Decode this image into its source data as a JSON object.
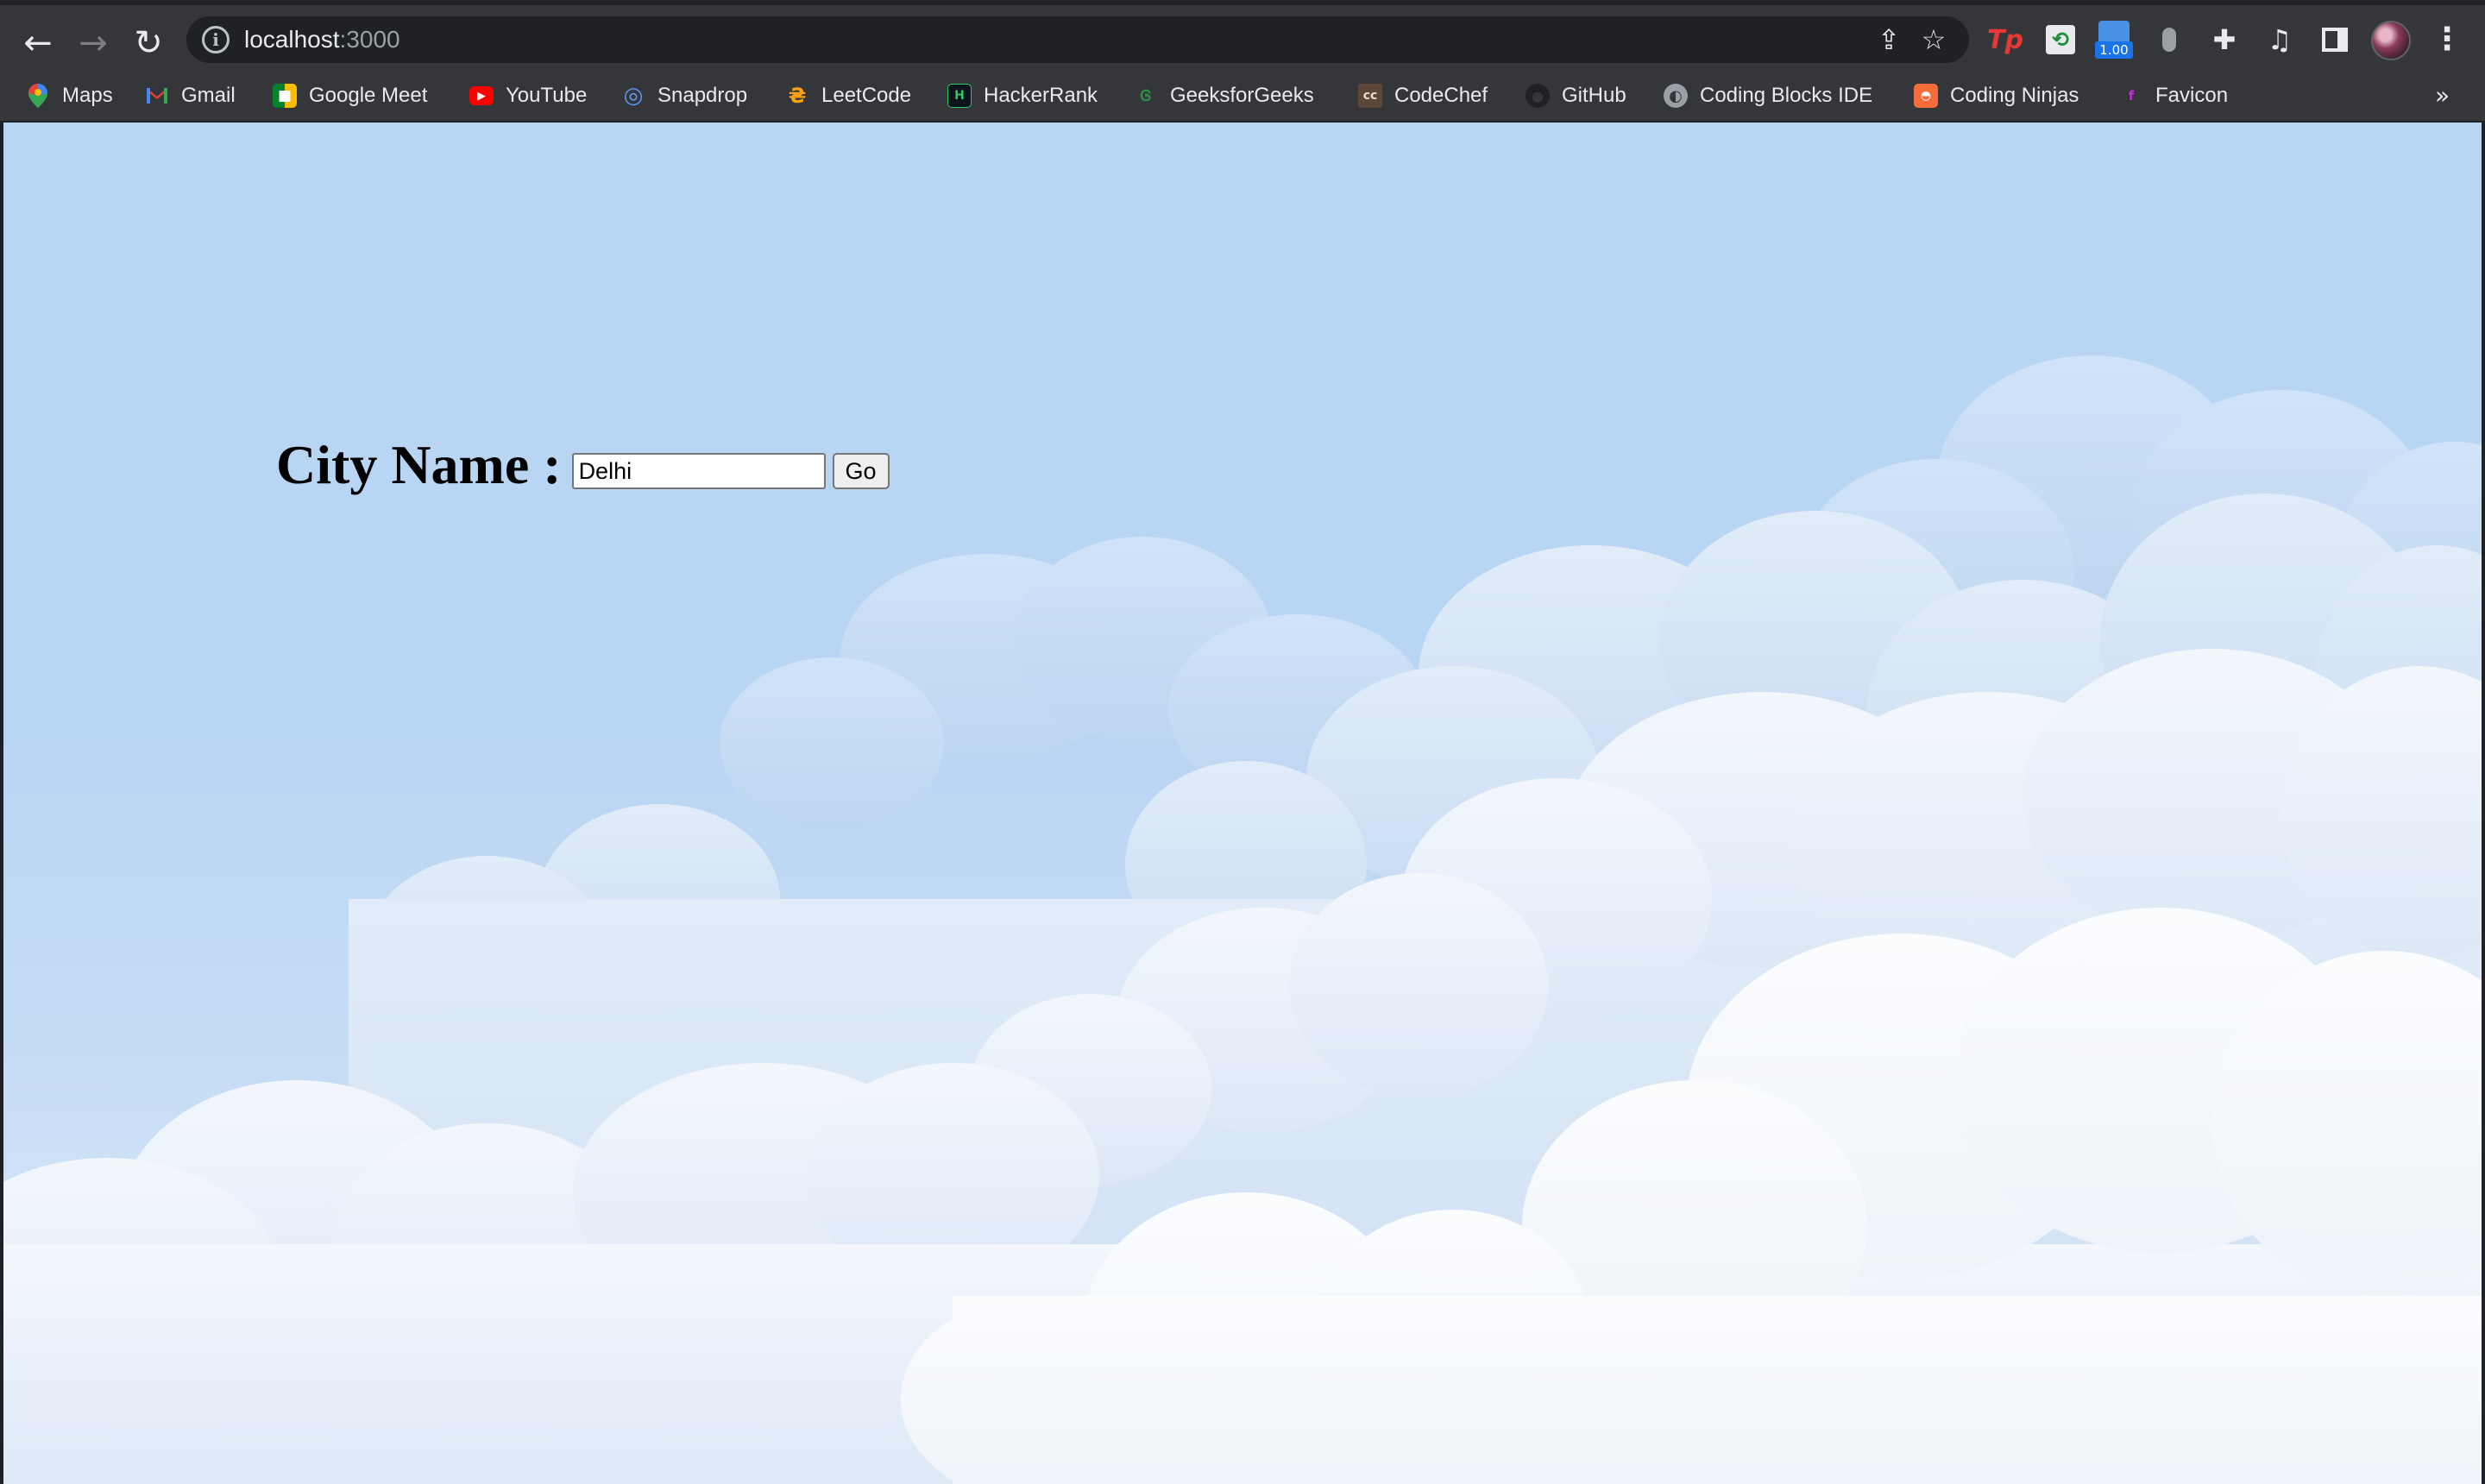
{
  "browser": {
    "url_host": "localhost",
    "url_port": ":3000",
    "ext_badge": "1.00"
  },
  "bookmarks": [
    {
      "label": "Maps",
      "icon": "maps-icon"
    },
    {
      "label": "Gmail",
      "icon": "gmail-icon"
    },
    {
      "label": "Google Meet",
      "icon": "google-meet-icon"
    },
    {
      "label": "YouTube",
      "icon": "youtube-icon"
    },
    {
      "label": "Snapdrop",
      "icon": "snapdrop-icon"
    },
    {
      "label": "LeetCode",
      "icon": "leetcode-icon"
    },
    {
      "label": "HackerRank",
      "icon": "hackerrank-icon"
    },
    {
      "label": "GeeksforGeeks",
      "icon": "geeksforgeeks-icon"
    },
    {
      "label": "CodeChef",
      "icon": "codechef-icon"
    },
    {
      "label": "GitHub",
      "icon": "github-icon"
    },
    {
      "label": "Coding Blocks IDE",
      "icon": "coding-blocks-icon"
    },
    {
      "label": "Coding Ninjas",
      "icon": "coding-ninjas-icon"
    },
    {
      "label": "Favicon",
      "icon": "favicon-icon"
    }
  ],
  "page": {
    "city_label": "City Name :",
    "city_value": "Delhi",
    "go_label": "Go"
  },
  "colors": {
    "sky_top": "#b8d5f4",
    "sky_bottom": "#dfeaf7",
    "chrome": "#35363a"
  }
}
